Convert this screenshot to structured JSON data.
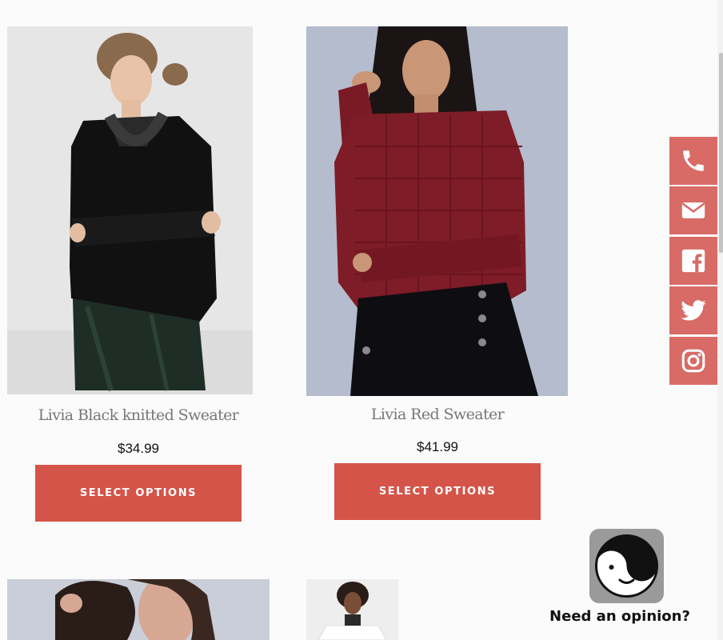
{
  "products": [
    {
      "title": "Livia Black knitted Sweater",
      "price": "$34.99",
      "button": "SELECT OPTIONS",
      "image": "woman-black-sweater-photo"
    },
    {
      "title": "Livia Red Sweater",
      "price": "$41.99",
      "button": "SELECT OPTIONS",
      "image": "woman-red-sweater-photo"
    }
  ],
  "next_row_images": [
    "woman-portrait-photo",
    "woman-white-sweater-photo"
  ],
  "social": [
    {
      "icon": "phone-icon"
    },
    {
      "icon": "envelope-icon"
    },
    {
      "icon": "facebook-icon"
    },
    {
      "icon": "twitter-icon"
    },
    {
      "icon": "instagram-icon"
    }
  ],
  "opinion_widget": {
    "label": "Need an opinion?",
    "icon": "yin-yang-face-icon"
  },
  "colors": {
    "button": "#d55449",
    "social": "#d86b66",
    "background": "#fbfbfb"
  }
}
